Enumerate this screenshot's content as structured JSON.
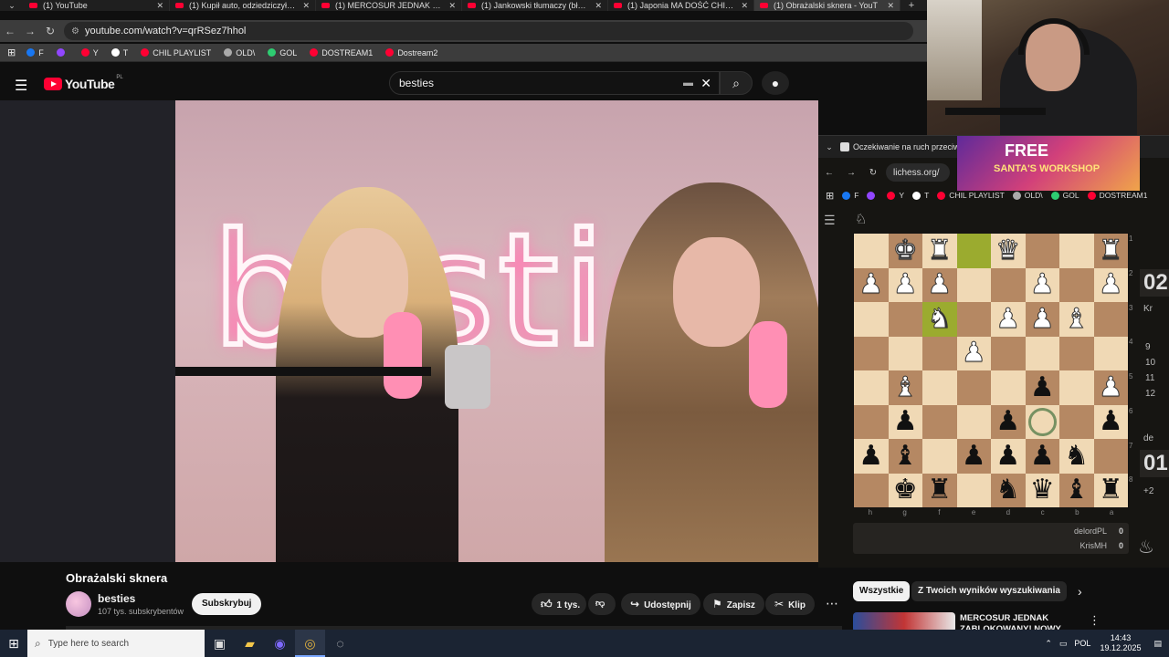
{
  "browser": {
    "tabs": [
      {
        "title": "(1) YouTube",
        "active": false
      },
      {
        "title": "(1) Kupił auto, odziedziczył dług",
        "active": false
      },
      {
        "title": "(1) MERCOSUR JEDNAK ZABLO",
        "active": false
      },
      {
        "title": "(1) Jankowski tłumaczy (błędnie",
        "active": false
      },
      {
        "title": "(1) Japonia MA DOŚĆ CHIN - B",
        "active": false
      },
      {
        "title": "(1) Obrażalski sknera - YouT",
        "active": true
      }
    ],
    "url": "youtube.com/watch?v=qrRSez7hhol",
    "bookmarks": [
      {
        "label": "F",
        "color": "#1877f2"
      },
      {
        "label": "",
        "color": "#9146ff"
      },
      {
        "label": "Y",
        "color": "#ff0033"
      },
      {
        "label": "T",
        "color": "#ffffff"
      },
      {
        "label": "CHIL PLAYLIST",
        "color": "#ff0033"
      },
      {
        "label": "OLD\\",
        "color": "#aaaaaa"
      },
      {
        "label": "GOL",
        "color": "#2ecc71"
      },
      {
        "label": "DOSTREAM1",
        "color": "#ff0033"
      },
      {
        "label": "Dostream2",
        "color": "#ff0033"
      }
    ]
  },
  "youtube": {
    "logo_text": "YouTube",
    "region": "PL",
    "search_value": "besties",
    "neon_sign": "besties",
    "video_title": "Obrażalski sknera",
    "channel_name": "besties",
    "channel_subs": "107 tys. subskrybentów",
    "subscribe_label": "Subskrybuj",
    "like_count": "1 tys.",
    "share_label": "Udostępnij",
    "save_label": "Zapisz",
    "clip_label": "Klip",
    "chip_all": "Wszystkie",
    "chip_results": "Z Twoich wyników wyszukiwania",
    "rec_title": "MERCOSUR JEDNAK ZABLOKOWANY! NOWY"
  },
  "lichess": {
    "tab_title": "Oczekiwanie na ruch przeciwn",
    "ad_line1": "FREE",
    "ad_line2": "SANTA'S WORKSHOP",
    "url": "lichess.org/",
    "bookmarks": [
      "F",
      "",
      "Y",
      "T",
      "CHIL PLAYLIST",
      "OLD\\",
      "GOL",
      "DOSTREAM1"
    ],
    "board_fen_rows": [
      ".KR.Q..R",
      "PPP..P.P",
      "..N.PPB.",
      "...P....",
      ".B...p.P",
      ".p..p..p",
      "pb.pppn.",
      ".kr.nqbr"
    ],
    "highlight_squares": [
      "f3",
      "e1"
    ],
    "ring_square": "c6",
    "ranks": [
      "1",
      "2",
      "3",
      "4",
      "5",
      "6",
      "7",
      "8"
    ],
    "files": [
      "h",
      "g",
      "f",
      "e",
      "d",
      "c",
      "b",
      "a"
    ],
    "players": [
      {
        "name": "delordPL",
        "score": "0"
      },
      {
        "name": "KrisMH",
        "score": "0"
      }
    ],
    "clock_top": "02",
    "clock_bottom": "01",
    "side_top_name": "Kr",
    "side_bottom_name": "de",
    "move_numbers": [
      "9",
      "10",
      "11",
      "12"
    ],
    "plus_count": "+2"
  },
  "taskbar": {
    "search_placeholder": "Type here to search",
    "lang": "POL",
    "time": "14:43",
    "date": "19.12.2025"
  },
  "colors": {
    "yt_red": "#ff0033",
    "board_light": "#f0d9b5",
    "board_dark": "#b58863",
    "highlight": "#9bab2f"
  }
}
